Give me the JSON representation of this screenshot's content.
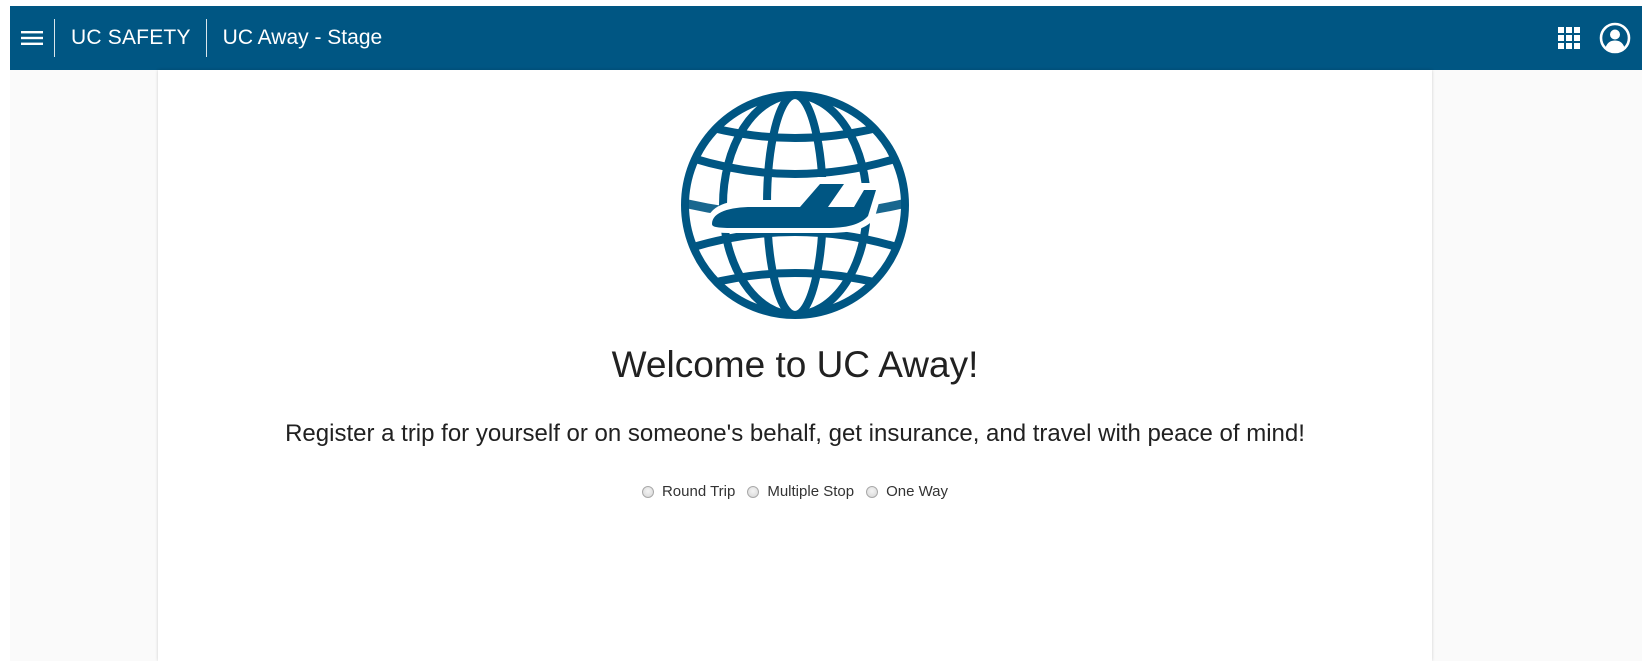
{
  "header": {
    "brand": "UC SAFETY",
    "app_title": "UC Away - Stage",
    "menu_icon": "hamburger-menu-icon",
    "apps_icon": "apps-grid-icon",
    "account_icon": "account-circle-icon",
    "background_color": "#005683"
  },
  "main": {
    "logo_icon": "globe-airplane-icon",
    "logo_color": "#005683",
    "welcome": "Welcome to UC Away!",
    "subtitle": "Register a trip for yourself or on someone's behalf, get insurance, and travel with peace of mind!",
    "trip_types": [
      {
        "label": "Round Trip",
        "selected": false
      },
      {
        "label": "Multiple Stop",
        "selected": false
      },
      {
        "label": "One Way",
        "selected": false
      }
    ]
  }
}
